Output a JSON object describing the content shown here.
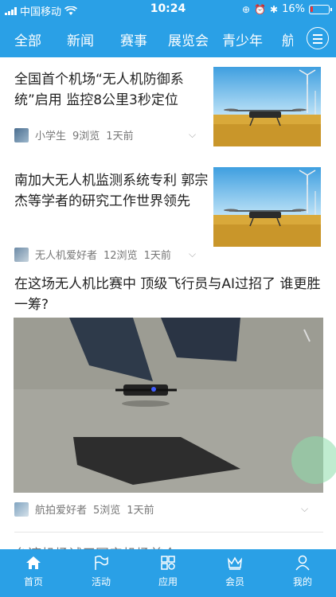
{
  "status": {
    "carrier": "中国移动",
    "time": "10:24",
    "battery": "16%",
    "battery_level": 0.16
  },
  "tabs": [
    "全部",
    "新闻",
    "赛事",
    "展览会",
    "青少年",
    "航"
  ],
  "articles": [
    {
      "title": "全国首个机场“无人机防御系统”启用 监控8公里3秒定位",
      "author": "小学生",
      "views": "9浏览",
      "time": "1天前"
    },
    {
      "title": "南加大无人机监测系统专利 郭宗杰等学者的研究工作世界领先",
      "author": "无人机爱好者",
      "views": "12浏览",
      "time": "1天前"
    },
    {
      "title": "在这场无人机比赛中 顶级飞行员与AI过招了 谁更胜一筹?",
      "author": "航拍爱好者",
      "views": "5浏览",
      "time": "1天前"
    },
    {
      "title": "台湾机场试用国产机场首个..."
    }
  ],
  "bottom_nav": [
    "首页",
    "活动",
    "应用",
    "会员",
    "我的"
  ],
  "colors": {
    "brand": "#2aa0e6"
  }
}
